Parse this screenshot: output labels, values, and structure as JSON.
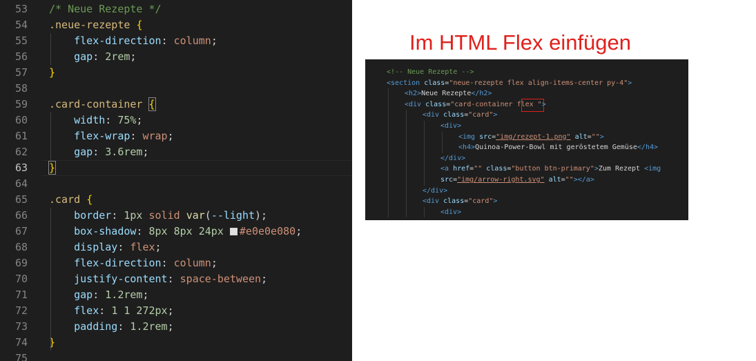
{
  "heading": "Im HTML Flex einfügen",
  "css_editor": {
    "lines": [
      {
        "n": "53",
        "tokens": [
          {
            "t": "/* Neue Rezepte */",
            "c": "comment"
          }
        ]
      },
      {
        "n": "54",
        "tokens": [
          {
            "t": ".neue-rezepte ",
            "c": "selector"
          },
          {
            "t": "{",
            "c": "brace"
          }
        ]
      },
      {
        "n": "55",
        "tokens": [
          {
            "t": "    flex-direction",
            "c": "prop"
          },
          {
            "t": ": ",
            "c": "punc"
          },
          {
            "t": "column",
            "c": "val"
          },
          {
            "t": ";",
            "c": "punc"
          }
        ]
      },
      {
        "n": "56",
        "tokens": [
          {
            "t": "    gap",
            "c": "prop"
          },
          {
            "t": ": ",
            "c": "punc"
          },
          {
            "t": "2rem",
            "c": "num"
          },
          {
            "t": ";",
            "c": "punc"
          }
        ]
      },
      {
        "n": "57",
        "tokens": [
          {
            "t": "}",
            "c": "brace"
          }
        ]
      },
      {
        "n": "58",
        "tokens": []
      },
      {
        "n": "59",
        "tokens": [
          {
            "t": ".card-container ",
            "c": "selector"
          },
          {
            "t": "{",
            "c": "brace",
            "m": true
          }
        ]
      },
      {
        "n": "60",
        "tokens": [
          {
            "t": "    width",
            "c": "prop"
          },
          {
            "t": ": ",
            "c": "punc"
          },
          {
            "t": "75%",
            "c": "num"
          },
          {
            "t": ";",
            "c": "punc"
          }
        ]
      },
      {
        "n": "61",
        "tokens": [
          {
            "t": "    flex-wrap",
            "c": "prop"
          },
          {
            "t": ": ",
            "c": "punc"
          },
          {
            "t": "wrap",
            "c": "val"
          },
          {
            "t": ";",
            "c": "punc"
          }
        ]
      },
      {
        "n": "62",
        "tokens": [
          {
            "t": "    gap",
            "c": "prop"
          },
          {
            "t": ": ",
            "c": "punc"
          },
          {
            "t": "3.6rem",
            "c": "num"
          },
          {
            "t": ";",
            "c": "punc"
          }
        ]
      },
      {
        "n": "63",
        "tokens": [
          {
            "t": "}",
            "c": "brace",
            "m": true
          }
        ],
        "current": true
      },
      {
        "n": "64",
        "tokens": []
      },
      {
        "n": "65",
        "tokens": [
          {
            "t": ".card ",
            "c": "selector"
          },
          {
            "t": "{",
            "c": "brace"
          }
        ]
      },
      {
        "n": "66",
        "tokens": [
          {
            "t": "    border",
            "c": "prop"
          },
          {
            "t": ": ",
            "c": "punc"
          },
          {
            "t": "1px",
            "c": "num"
          },
          {
            "t": " solid ",
            "c": "val"
          },
          {
            "t": "var",
            "c": "fn"
          },
          {
            "t": "(",
            "c": "punc"
          },
          {
            "t": "--light",
            "c": "var"
          },
          {
            "t": ");",
            "c": "punc"
          }
        ]
      },
      {
        "n": "67",
        "tokens": [
          {
            "t": "    box-shadow",
            "c": "prop"
          },
          {
            "t": ": ",
            "c": "punc"
          },
          {
            "t": "8px",
            "c": "num"
          },
          {
            "t": " ",
            "c": "punc"
          },
          {
            "t": "8px",
            "c": "num"
          },
          {
            "t": " ",
            "c": "punc"
          },
          {
            "t": "24px",
            "c": "num"
          },
          {
            "t": " ",
            "c": "punc"
          },
          {
            "t": "",
            "c": "swatch"
          },
          {
            "t": "#e0e0e080",
            "c": "val"
          },
          {
            "t": ";",
            "c": "punc"
          }
        ]
      },
      {
        "n": "68",
        "tokens": [
          {
            "t": "    display",
            "c": "prop"
          },
          {
            "t": ": ",
            "c": "punc"
          },
          {
            "t": "flex",
            "c": "val"
          },
          {
            "t": ";",
            "c": "punc"
          }
        ]
      },
      {
        "n": "69",
        "tokens": [
          {
            "t": "    flex-direction",
            "c": "prop"
          },
          {
            "t": ": ",
            "c": "punc"
          },
          {
            "t": "column",
            "c": "val"
          },
          {
            "t": ";",
            "c": "punc"
          }
        ]
      },
      {
        "n": "70",
        "tokens": [
          {
            "t": "    justify-content",
            "c": "prop"
          },
          {
            "t": ": ",
            "c": "punc"
          },
          {
            "t": "space-between",
            "c": "val"
          },
          {
            "t": ";",
            "c": "punc"
          }
        ]
      },
      {
        "n": "71",
        "tokens": [
          {
            "t": "    gap",
            "c": "prop"
          },
          {
            "t": ": ",
            "c": "punc"
          },
          {
            "t": "1.2rem",
            "c": "num"
          },
          {
            "t": ";",
            "c": "punc"
          }
        ]
      },
      {
        "n": "72",
        "tokens": [
          {
            "t": "    flex",
            "c": "prop"
          },
          {
            "t": ": ",
            "c": "punc"
          },
          {
            "t": "1 1 272px",
            "c": "num"
          },
          {
            "t": ";",
            "c": "punc"
          }
        ]
      },
      {
        "n": "73",
        "tokens": [
          {
            "t": "    padding",
            "c": "prop"
          },
          {
            "t": ": ",
            "c": "punc"
          },
          {
            "t": "1.2rem",
            "c": "num"
          },
          {
            "t": ";",
            "c": "punc"
          }
        ]
      },
      {
        "n": "74",
        "tokens": [
          {
            "t": "}",
            "c": "brace"
          }
        ]
      },
      {
        "n": "75",
        "tokens": []
      }
    ]
  },
  "html_panel": {
    "lines": [
      {
        "i": 0,
        "tokens": [
          {
            "t": "<!-- Neue Rezepte -->",
            "c": "comment"
          }
        ]
      },
      {
        "i": 0,
        "tokens": [
          {
            "t": "<section ",
            "c": "tag"
          },
          {
            "t": "class",
            "c": "attr"
          },
          {
            "t": "=",
            "c": "text"
          },
          {
            "t": "\"neue-rezepte flex align-items-center py-4\"",
            "c": "str"
          },
          {
            "t": ">",
            "c": "tag"
          }
        ]
      },
      {
        "i": 1,
        "tokens": [
          {
            "t": "<h2>",
            "c": "tag"
          },
          {
            "t": "Neue Rezepte",
            "c": "text"
          },
          {
            "t": "</h2>",
            "c": "tag"
          }
        ]
      },
      {
        "i": 1,
        "tokens": [
          {
            "t": "<div ",
            "c": "tag"
          },
          {
            "t": "class",
            "c": "attr"
          },
          {
            "t": "=",
            "c": "text"
          },
          {
            "t": "\"card-container flex \"",
            "c": "str"
          },
          {
            "t": ">",
            "c": "tag"
          }
        ]
      },
      {
        "i": 2,
        "tokens": [
          {
            "t": "<div ",
            "c": "tag"
          },
          {
            "t": "class",
            "c": "attr"
          },
          {
            "t": "=",
            "c": "text"
          },
          {
            "t": "\"card\"",
            "c": "str"
          },
          {
            "t": ">",
            "c": "tag"
          }
        ]
      },
      {
        "i": 3,
        "tokens": [
          {
            "t": "<div>",
            "c": "tag"
          }
        ]
      },
      {
        "i": 4,
        "tokens": [
          {
            "t": "<img ",
            "c": "tag"
          },
          {
            "t": "src",
            "c": "attr"
          },
          {
            "t": "=",
            "c": "text"
          },
          {
            "t": "\"img/rezept-1.png\"",
            "c": "strlink"
          },
          {
            "t": " ",
            "c": "text"
          },
          {
            "t": "alt",
            "c": "attr"
          },
          {
            "t": "=",
            "c": "text"
          },
          {
            "t": "\"\"",
            "c": "str"
          },
          {
            "t": ">",
            "c": "tag"
          }
        ]
      },
      {
        "i": 4,
        "tokens": [
          {
            "t": "<h4>",
            "c": "tag"
          },
          {
            "t": "Quinoa-Power-Bowl mit geröstetem Gemüse",
            "c": "text"
          },
          {
            "t": "</h4>",
            "c": "tag"
          }
        ]
      },
      {
        "i": 3,
        "tokens": [
          {
            "t": "</div>",
            "c": "tag"
          }
        ]
      },
      {
        "i": 3,
        "tokens": [
          {
            "t": "<a ",
            "c": "tag"
          },
          {
            "t": "href",
            "c": "attr"
          },
          {
            "t": "=",
            "c": "text"
          },
          {
            "t": "\"\"",
            "c": "str"
          },
          {
            "t": " ",
            "c": "text"
          },
          {
            "t": "class",
            "c": "attr"
          },
          {
            "t": "=",
            "c": "text"
          },
          {
            "t": "\"button btn-primary\"",
            "c": "str"
          },
          {
            "t": ">",
            "c": "tag"
          },
          {
            "t": "Zum Rezept ",
            "c": "text"
          },
          {
            "t": "<img",
            "c": "tag"
          }
        ]
      },
      {
        "i": 3,
        "tokens": [
          {
            "t": "src",
            "c": "attr"
          },
          {
            "t": "=",
            "c": "text"
          },
          {
            "t": "\"img/arrow-right.svg\"",
            "c": "strlink"
          },
          {
            "t": " ",
            "c": "text"
          },
          {
            "t": "alt",
            "c": "attr"
          },
          {
            "t": "=",
            "c": "text"
          },
          {
            "t": "\"\"",
            "c": "str"
          },
          {
            "t": ">",
            "c": "tag"
          },
          {
            "t": "</a>",
            "c": "tag"
          }
        ]
      },
      {
        "i": 2,
        "tokens": [
          {
            "t": "</div>",
            "c": "tag"
          }
        ]
      },
      {
        "i": 2,
        "tokens": [
          {
            "t": "<div ",
            "c": "tag"
          },
          {
            "t": "class",
            "c": "attr"
          },
          {
            "t": "=",
            "c": "text"
          },
          {
            "t": "\"card\"",
            "c": "str"
          },
          {
            "t": ">",
            "c": "tag"
          }
        ]
      },
      {
        "i": 3,
        "tokens": [
          {
            "t": "<div>",
            "c": "tag"
          }
        ]
      }
    ]
  }
}
